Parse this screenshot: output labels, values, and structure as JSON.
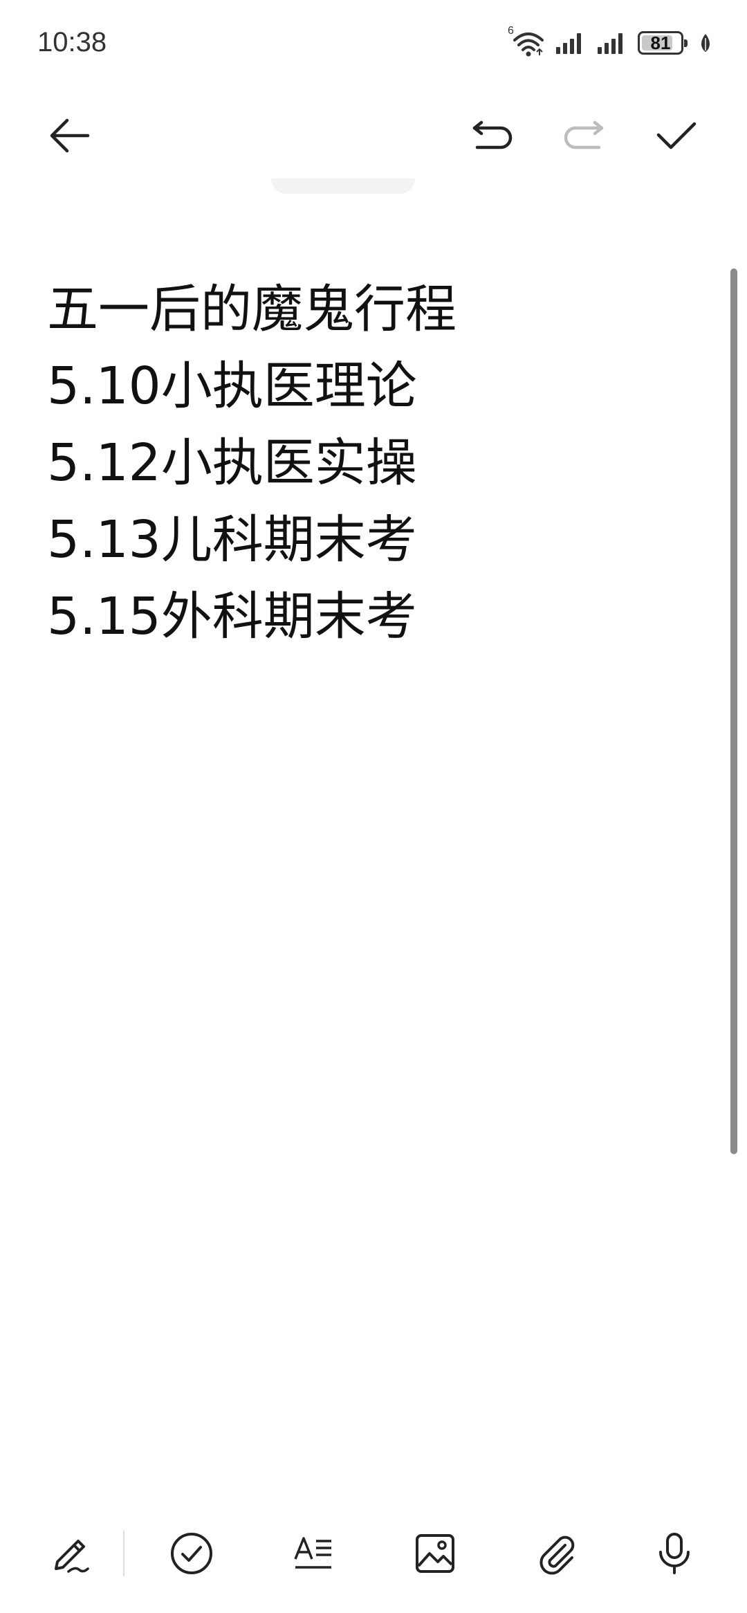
{
  "status_bar": {
    "time": "10:38",
    "wifi_badge": "6",
    "battery_level": "81",
    "battery_fraction": 0.81,
    "icons": [
      "wifi-6-icon",
      "signal-icon",
      "signal-icon",
      "battery-icon",
      "leaf-icon"
    ]
  },
  "toolbar": {
    "icons": [
      "back-arrow-icon",
      "undo-icon",
      "redo-icon",
      "checkmark-icon"
    ]
  },
  "note": {
    "lines": [
      "五一后的魔鬼行程",
      "5.10小执医理论",
      "5.12小执医实操",
      "5.13儿科期末考",
      "5.15外科期末考"
    ]
  },
  "bottom_toolbar": {
    "icons": [
      "handwriting-pen-icon",
      "checklist-icon",
      "text-format-icon",
      "image-icon",
      "attachment-icon",
      "microphone-icon"
    ]
  },
  "colors": {
    "text": "#111111",
    "icon": "#222222",
    "icon_disabled": "#bdbdbd",
    "background": "#ffffff"
  }
}
